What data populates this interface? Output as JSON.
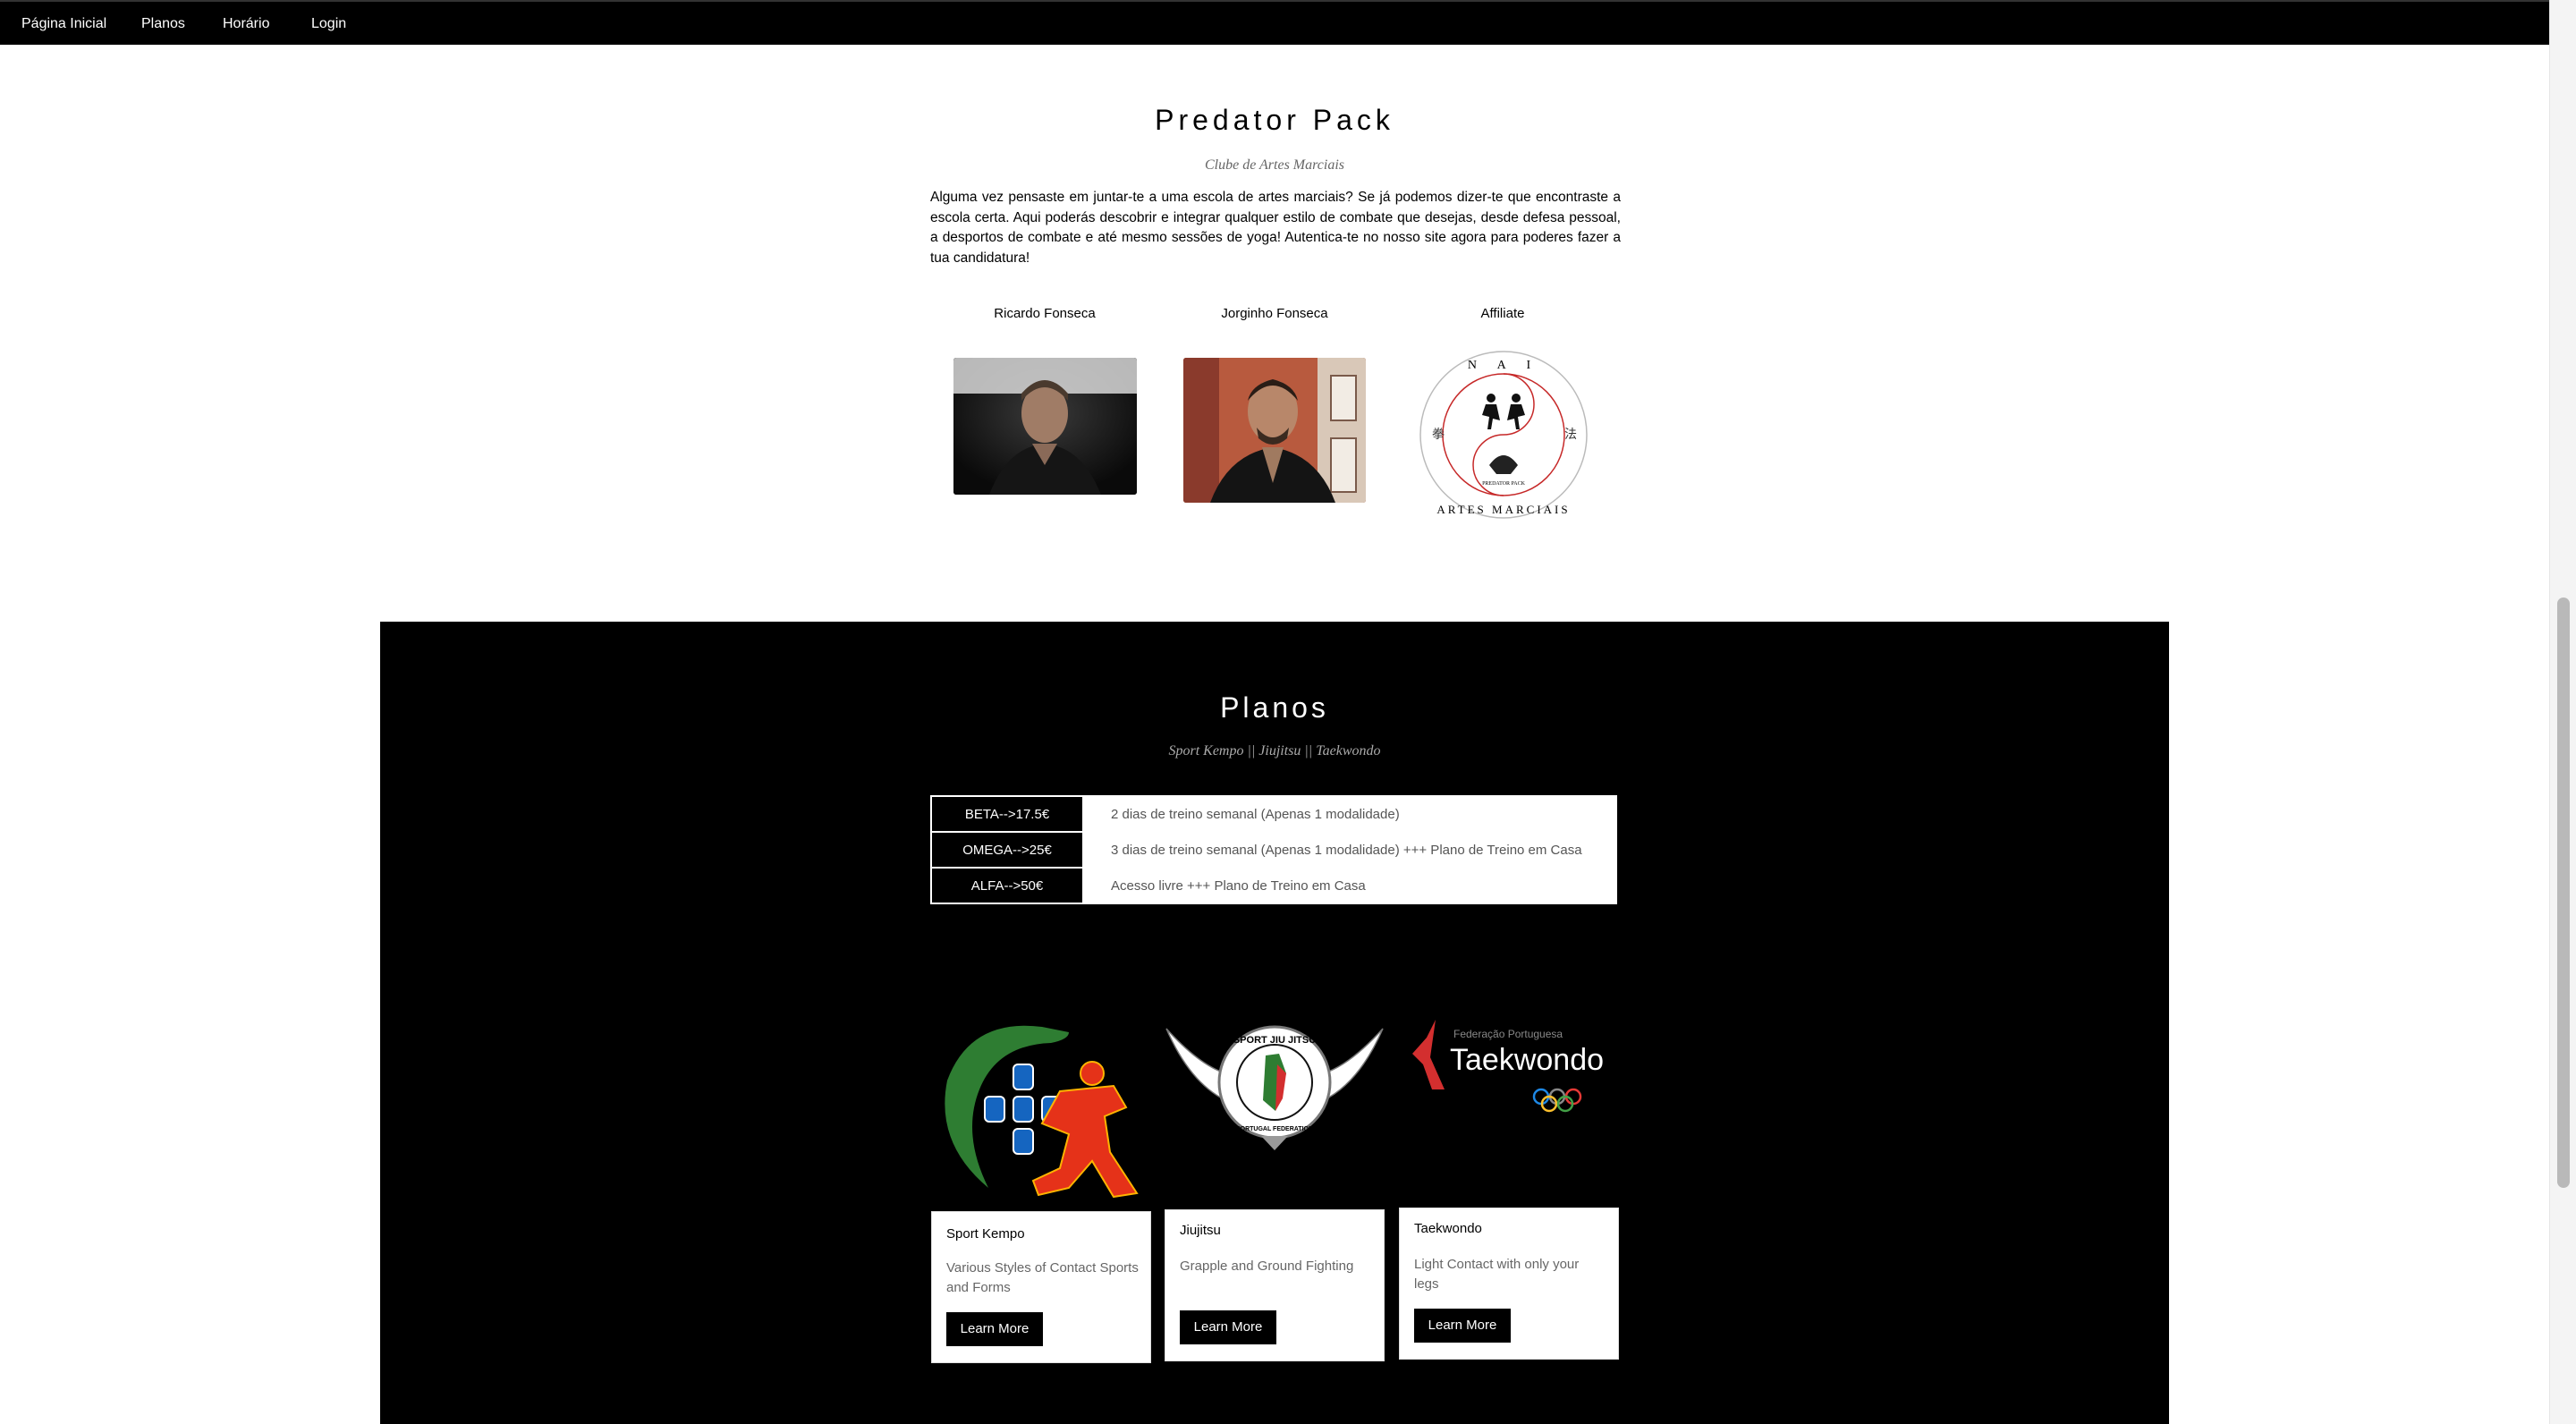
{
  "nav": {
    "items": [
      "Página Inicial",
      "Planos",
      "Horário",
      "Login"
    ]
  },
  "header": {
    "title": "Predator Pack",
    "subtitle": "Clube de Artes Marciais",
    "intro": "Alguma vez pensaste em juntar-te a uma escola de artes marciais? Se já podemos dizer-te que encontraste a escola certa. Aqui poderás descobrir e integrar qualquer estilo de combate que desejas, desde defesa pessoal, a desportos de combate e até mesmo sessões de yoga! Autentica-te no nosso site agora para poderes fazer a tua candidatura!"
  },
  "people": [
    {
      "label": "Ricardo Fonseca"
    },
    {
      "label": "Jorginho Fonseca"
    },
    {
      "label": "Affiliate"
    }
  ],
  "affiliate_logo_text": {
    "top": "N A I",
    "bottom": "ARTES MARCIAIS",
    "center": "PREDATOR PACK"
  },
  "planos": {
    "title": "Planos",
    "subtitle": "Sport Kempo || Jiujitsu || Taekwondo",
    "rows": [
      {
        "name": "BETA-->17.5€",
        "desc": "2 dias de treino semanal (Apenas 1 modalidade)"
      },
      {
        "name": "OMEGA-->25€",
        "desc": "3 dias de treino semanal (Apenas 1 modalidade) +++ Plano de Treino em Casa"
      },
      {
        "name": "ALFA-->50€",
        "desc": "Acesso livre +++ Plano de Treino em Casa"
      }
    ]
  },
  "cards": [
    {
      "title": "Sport Kempo",
      "desc": "Various Styles of Contact Sports and Forms",
      "button": "Learn More"
    },
    {
      "title": "Jiujitsu",
      "desc": "Grapple and Ground Fighting",
      "button": "Learn More"
    },
    {
      "title": "Taekwondo",
      "desc": "Light Contact with only your legs",
      "button": "Learn More"
    }
  ],
  "logos": {
    "jiujitsu_ring": "SPORT JIU JITSU",
    "jiujitsu_bottom": "PORTUGAL FEDERATION",
    "taekwondo_small": "Federação Portuguesa",
    "taekwondo_big": "Taekwondo"
  },
  "colors": {
    "nav_bg": "#000000",
    "section_bg": "#000000",
    "button_bg": "#000000",
    "kempo_green": "#2e7d32",
    "kempo_red": "#e53219",
    "taekwondo_red": "#d32f2f"
  }
}
